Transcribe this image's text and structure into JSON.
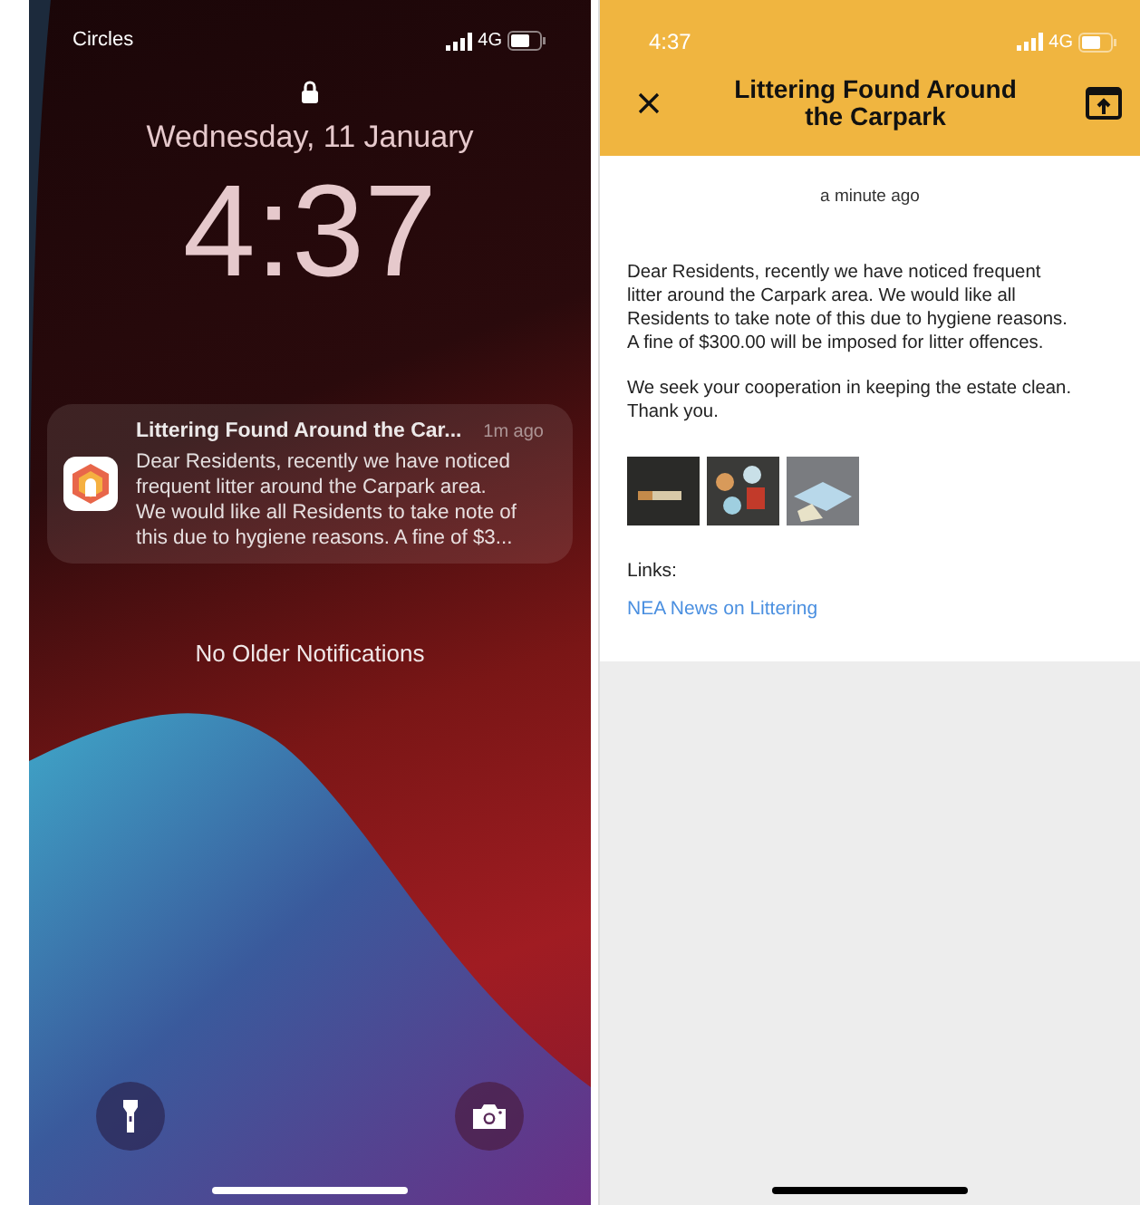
{
  "lock_screen": {
    "carrier": "Circles",
    "network": "4G",
    "date": "Wednesday, 11 January",
    "time": "4:37",
    "notification": {
      "title": "Littering Found Around the Car...",
      "time": "1m ago",
      "body": "Dear Residents, recently we have noticed\nfrequent litter around the Carpark area.\nWe would like all Residents to take note of\nthis due to hygiene reasons. A fine of $3..."
    },
    "footer_text": "No Older Notifications"
  },
  "detail_screen": {
    "status_time": "4:37",
    "network": "4G",
    "title": "Littering Found Around the Carpark",
    "timestamp": "a minute ago",
    "paragraphs": [
      "Dear Residents, recently we have noticed frequent\nlitter around the Carpark area. We would like all\nResidents to take note of this due to hygiene reasons.\nA fine of $300.00 will be imposed for litter offences.",
      "We seek your cooperation in keeping the estate clean.\nThank you."
    ],
    "photos": [
      {
        "kind": "cigarette"
      },
      {
        "kind": "cans"
      },
      {
        "kind": "mask"
      }
    ],
    "links_label": "Links:",
    "links": [
      "NEA News on Littering"
    ]
  }
}
